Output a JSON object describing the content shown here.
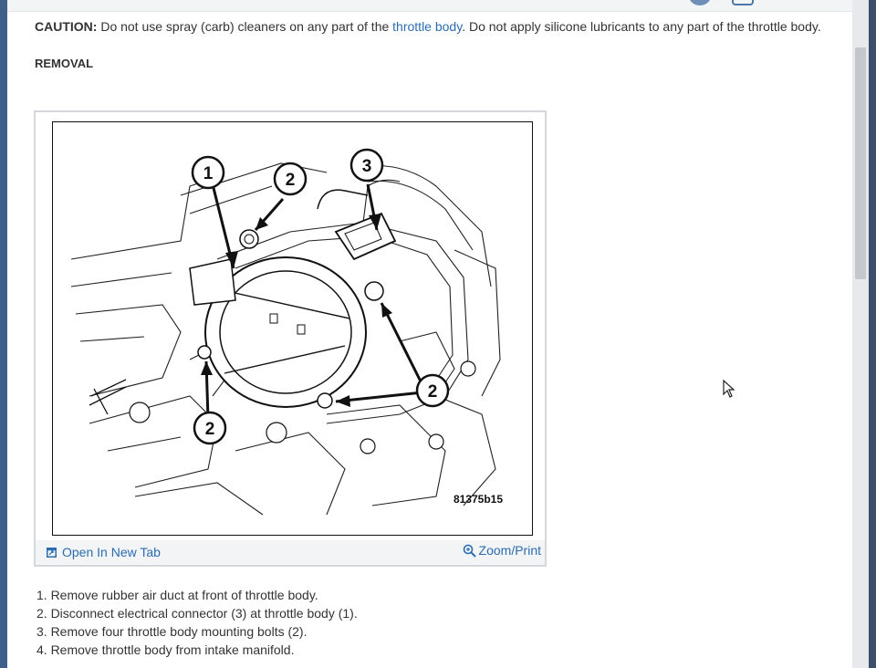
{
  "caution": {
    "label": "CAUTION:",
    "text_before": "Do not use spray (carb) cleaners on any part of the",
    "link": "throttle body",
    "text_after": ". Do not apply silicone lubricants to any part of the throttle body."
  },
  "section_heading": "REMOVAL",
  "figure": {
    "code": "81375b15",
    "callouts": [
      "1",
      "2",
      "3",
      "2",
      "2"
    ],
    "open_tab_label": "Open In New Tab",
    "zoom_label": "Zoom/Print",
    "open_tab_icon": "open-in-new-tab-icon",
    "zoom_icon": "zoom-magnifier-icon"
  },
  "steps": [
    "1. Remove rubber air duct at front of throttle body.",
    "2. Disconnect electrical connector (3) at throttle body (1).",
    "3. Remove four throttle body mounting bolts (2).",
    "4. Remove throttle body from intake manifold."
  ],
  "colors": {
    "link": "#2b6cb0",
    "scroll_thumb": "#c4c8cd"
  }
}
